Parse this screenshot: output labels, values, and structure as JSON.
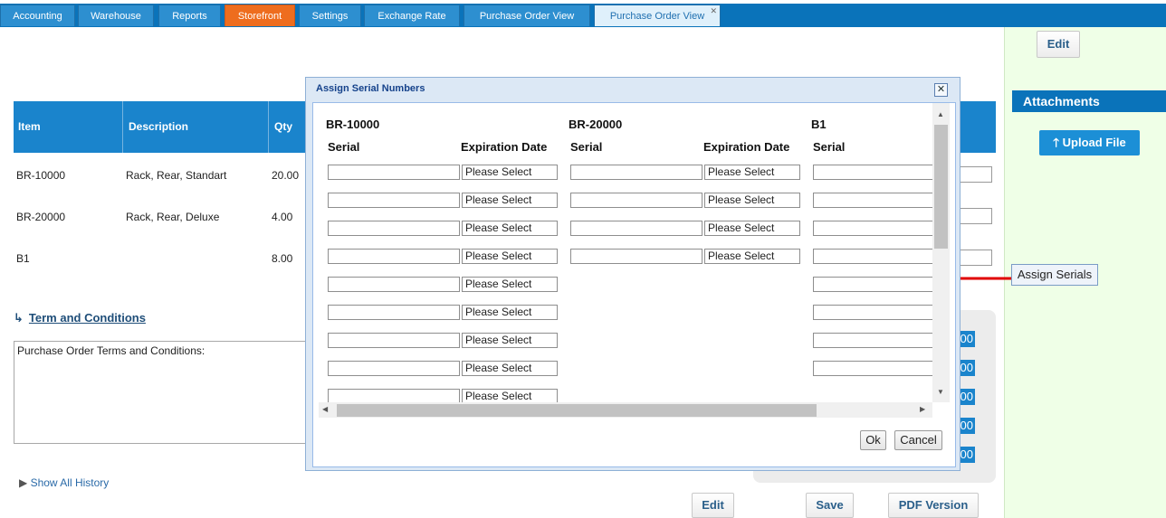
{
  "tabs": [
    {
      "label": "Accounting"
    },
    {
      "label": "Warehouse"
    },
    {
      "label": "Reports"
    },
    {
      "label": "Storefront"
    },
    {
      "label": "Settings"
    },
    {
      "label": "Exchange Rate"
    },
    {
      "label": "Purchase Order View"
    },
    {
      "label": "Purchase Order View"
    }
  ],
  "right_panel": {
    "edit_label": "Edit",
    "attachments_label": "Attachments",
    "upload_label": "Upload File"
  },
  "assign_serials_label": "Assign Serials",
  "grid": {
    "headers": [
      "Item",
      "Description",
      "Qty"
    ],
    "rows": [
      {
        "item": "BR-10000",
        "description": "Rack, Rear, Standart",
        "qty": "20.00"
      },
      {
        "item": "BR-20000",
        "description": "Rack, Rear, Deluxe",
        "qty": "4.00"
      },
      {
        "item": "B1",
        "description": "",
        "qty": "8.00"
      }
    ]
  },
  "terms": {
    "link_label": "Term and Conditions",
    "text": "Purchase Order Terms and Conditions:"
  },
  "history_label": "Show All History",
  "totals_suffix": "00",
  "bottom_buttons": {
    "edit": "Edit",
    "save": "Save",
    "pdf": "PDF Version"
  },
  "modal": {
    "title": "Assign Serial Numbers",
    "close_label": "✕",
    "products": [
      "BR-10000",
      "BR-20000",
      "B1"
    ],
    "serial_header": "Serial",
    "expiration_header": "Expiration Date",
    "date_placeholder": "Please Select",
    "ok_label": "Ok",
    "cancel_label": "Cancel"
  },
  "colors": {
    "nav_blue": "#0a73ba",
    "grid_header": "#1a84cc",
    "storefront_tab": "#ee6d1e",
    "right_panel": "#efffe7",
    "arrow": "#e00000"
  }
}
